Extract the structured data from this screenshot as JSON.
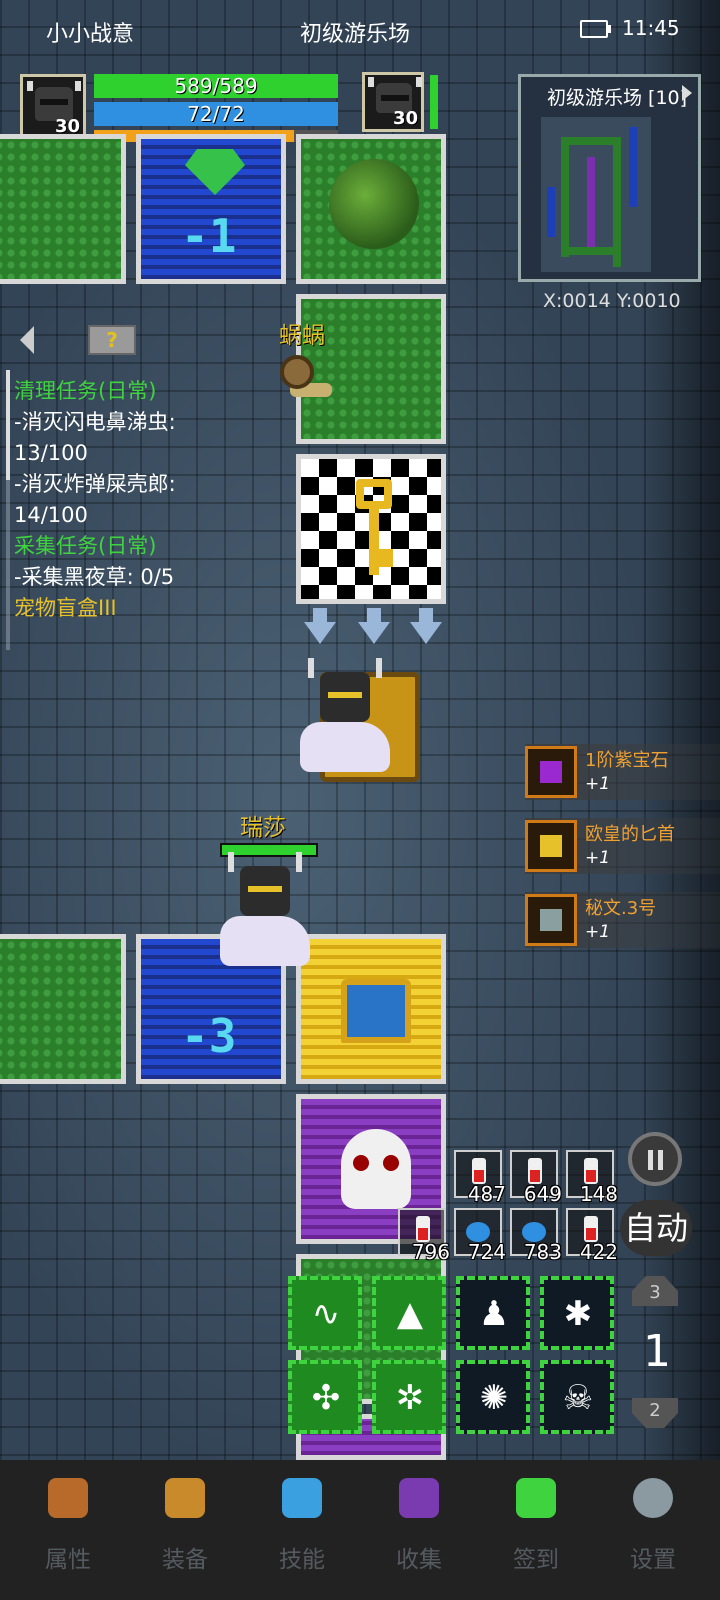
{
  "status_bar": {
    "app_name": "小小战意",
    "location": "初级游乐场",
    "time": "11:45"
  },
  "player": {
    "level": "30",
    "hp_text": "589/589",
    "mp_text": "72/72",
    "xp_fraction": 0.82,
    "name": "瑞莎"
  },
  "pet": {
    "level": "30",
    "hp_fraction": 1.0
  },
  "minimap": {
    "title": "初级游乐场 [10]",
    "coords": "X:0014  Y:0010"
  },
  "tiles": {
    "top_blue_value": "-1",
    "mid_blue_value": "-3"
  },
  "monster": {
    "name": "蜗蜗"
  },
  "quests": {
    "help_icon": "?",
    "lines": [
      {
        "text": "清理任务(日常)",
        "style": "g"
      },
      {
        "text": "-消灭闪电鼻涕虫:",
        "style": "w"
      },
      {
        "text": "13/100",
        "style": "w"
      },
      {
        "text": "-消灭炸弹屎壳郎:",
        "style": "w"
      },
      {
        "text": "14/100",
        "style": "w"
      },
      {
        "text": "采集任务(日常)",
        "style": "g"
      },
      {
        "text": "-采集黑夜草: 0/5",
        "style": "w"
      },
      {
        "text": "宠物盲盒III",
        "style": "y"
      }
    ]
  },
  "loot": [
    {
      "name": "1阶紫宝石",
      "count": "+1",
      "icon": "purple-gem-icon",
      "color": "#9a2ad0"
    },
    {
      "name": "欧皇的匕首",
      "count": "+1",
      "icon": "dagger-icon",
      "color": "#e6c12a"
    },
    {
      "name": "秘文.3号",
      "count": "+1",
      "icon": "rune-stone-icon",
      "color": "#8aa0a0"
    }
  ],
  "potions": [
    {
      "count": "487",
      "type": "red"
    },
    {
      "count": "649",
      "type": "red"
    },
    {
      "count": "148",
      "type": "red"
    },
    {
      "count": "796",
      "type": "red"
    },
    {
      "count": "724",
      "type": "blue"
    },
    {
      "count": "783",
      "type": "blue"
    },
    {
      "count": "422",
      "type": "red"
    }
  ],
  "controls": {
    "auto_label": "自动",
    "floor_up": "3",
    "floor_current": "1",
    "floor_down": "2"
  },
  "nav": [
    {
      "label": "属性",
      "icon": "helmet-icon"
    },
    {
      "label": "装备",
      "icon": "bag-icon"
    },
    {
      "label": "技能",
      "icon": "skill-orb-icon"
    },
    {
      "label": "收集",
      "icon": "collection-book-icon"
    },
    {
      "label": "签到",
      "icon": "green-gem-icon"
    },
    {
      "label": "设置",
      "icon": "gear-icon"
    }
  ]
}
